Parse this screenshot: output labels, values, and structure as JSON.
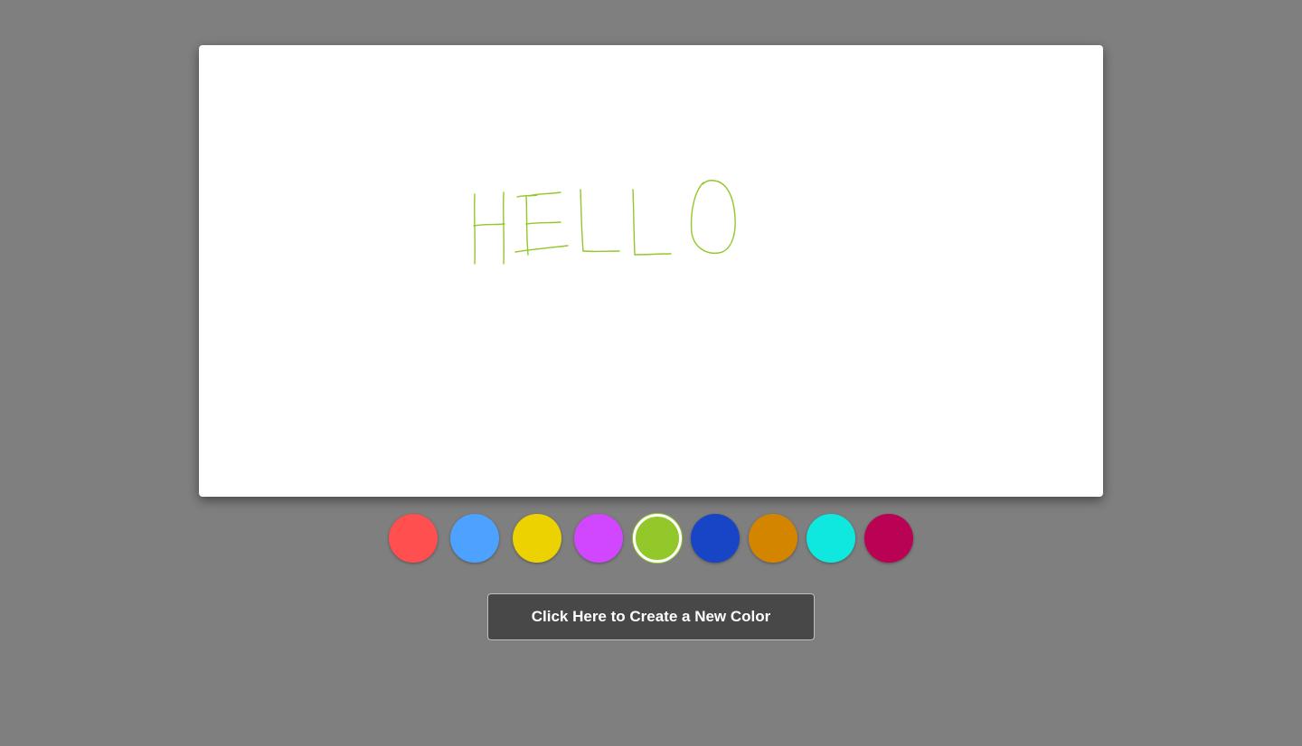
{
  "canvas": {
    "stroke_color": "#92c82a",
    "drawn_text": "HELLO"
  },
  "palette": {
    "colors": [
      {
        "name": "red",
        "hex": "#ff4f4f",
        "selected": false
      },
      {
        "name": "blue",
        "hex": "#4ea2ff",
        "selected": false
      },
      {
        "name": "yellow",
        "hex": "#ecd200",
        "selected": false
      },
      {
        "name": "purple",
        "hex": "#d047ff",
        "selected": false
      },
      {
        "name": "green",
        "hex": "#92c82a",
        "selected": true
      },
      {
        "name": "dark-blue",
        "hex": "#1745c6",
        "selected": false
      },
      {
        "name": "orange",
        "hex": "#d48500",
        "selected": false
      },
      {
        "name": "cyan",
        "hex": "#0ee8df",
        "selected": false
      },
      {
        "name": "crimson",
        "hex": "#b90254",
        "selected": false
      }
    ]
  },
  "actions": {
    "new_color_label": "Click Here to Create a New Color"
  }
}
